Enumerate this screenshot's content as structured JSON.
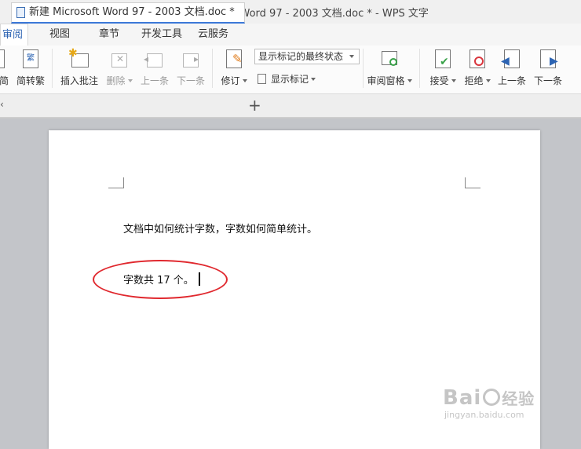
{
  "window": {
    "title": "新建 Microsoft Word 97 - 2003 文档.doc * - WPS 文字"
  },
  "menu_tabs": [
    "审阅",
    "视图",
    "章节",
    "开发工具",
    "云服务"
  ],
  "ribbon": {
    "jian_label": "简",
    "fanzhuanjian_label": "简转繁",
    "insert_comment": "插入批注",
    "delete": "删除",
    "prev_comment": "上一条",
    "next_comment": "下一条",
    "track_changes": "修订",
    "markup_state": "显示标记的最终状态",
    "show_markup": "显示标记",
    "review_pane": "审阅窗格",
    "accept": "接受",
    "reject": "拒绝",
    "prev_change": "上一条",
    "next_change": "下一条"
  },
  "doc_tab": {
    "name": "新建 Microsoft Word 97 - 2003 文档.doc *",
    "add": "+"
  },
  "document": {
    "line1": "文档中如何统计字数，字数如何简单统计。",
    "line2": "字数共 17 个。"
  },
  "watermark": {
    "brand": "Bai",
    "brand2": "经验",
    "url": "jingyan.baidu.com"
  },
  "colors": {
    "accent": "#2d64b3",
    "highlight_ellipse": "#e0282e"
  }
}
